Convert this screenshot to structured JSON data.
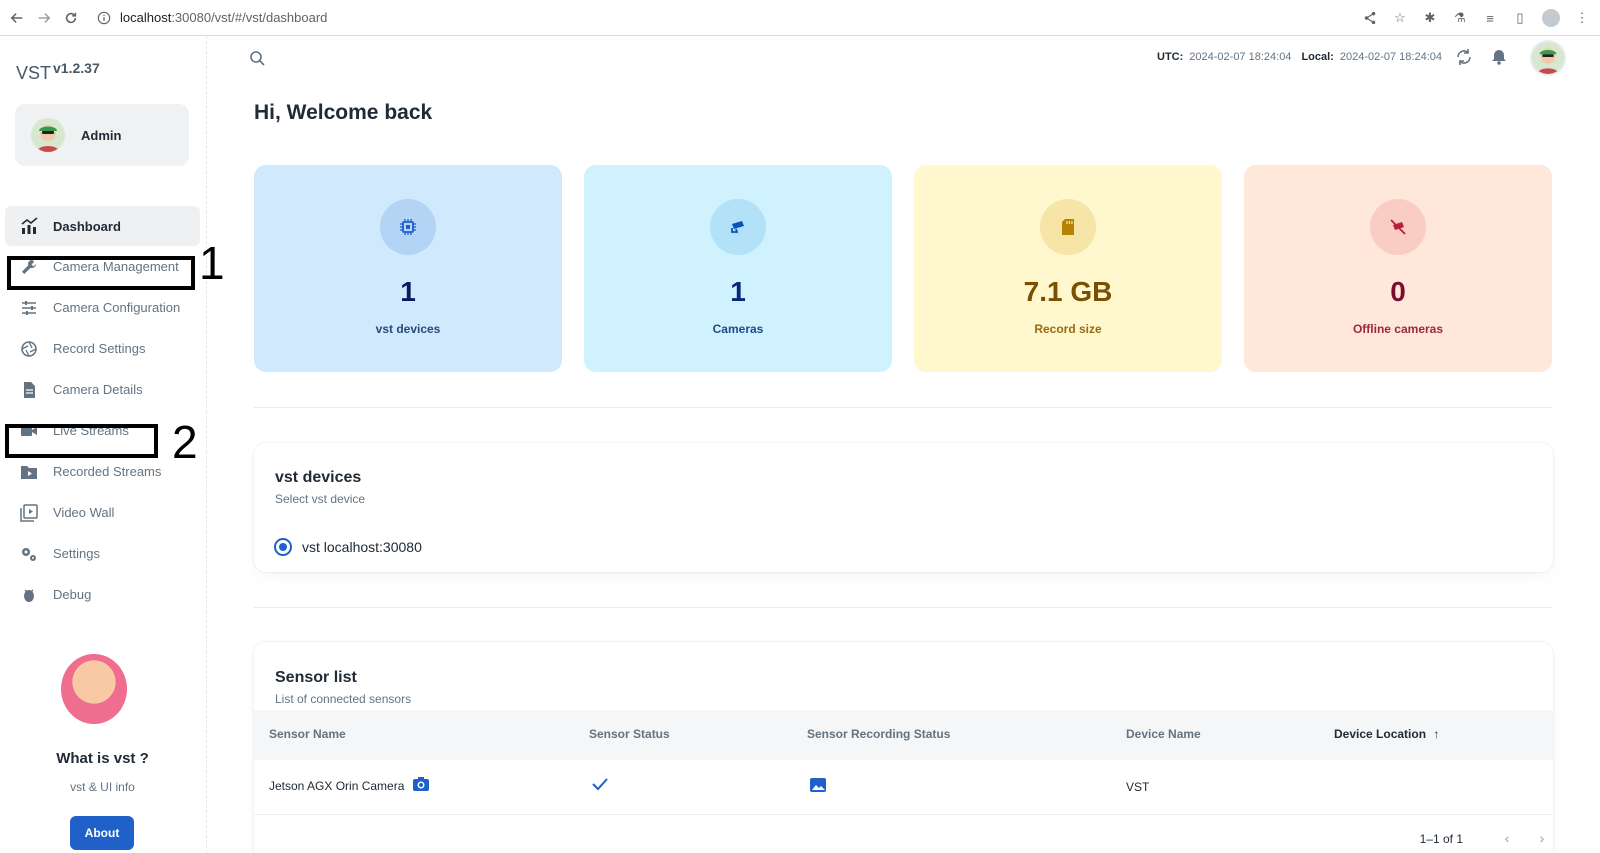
{
  "browser": {
    "url_host": "localhost",
    "url_rest": ":30080/vst/#/vst/dashboard"
  },
  "app": {
    "name": "VST",
    "version": "v1.2.37"
  },
  "user": {
    "name": "Admin"
  },
  "sidebar": {
    "items": [
      {
        "label": "Dashboard",
        "icon": "chart-icon",
        "active": true
      },
      {
        "label": "Camera Management",
        "icon": "wrench-icon"
      },
      {
        "label": "Camera Configuration",
        "icon": "sliders-icon"
      },
      {
        "label": "Record Settings",
        "icon": "aperture-icon"
      },
      {
        "label": "Camera Details",
        "icon": "document-icon"
      },
      {
        "label": "Live Streams",
        "icon": "videocam-icon"
      },
      {
        "label": "Recorded Streams",
        "icon": "folder-video-icon"
      },
      {
        "label": "Video Wall",
        "icon": "video-library-icon"
      },
      {
        "label": "Settings",
        "icon": "gears-icon"
      },
      {
        "label": "Debug",
        "icon": "bug-icon"
      }
    ],
    "annotations": [
      "1",
      "2"
    ],
    "promo": {
      "title": "What is vst ?",
      "subtitle": "vst & UI info",
      "button": "About"
    }
  },
  "topbar": {
    "utc_label": "UTC:",
    "utc_value": "2024-02-07 18:24:04",
    "local_label": "Local:",
    "local_value": "2024-02-07 18:24:04"
  },
  "welcome": "Hi, Welcome back",
  "stats": [
    {
      "value": "1",
      "label": "vst devices",
      "icon": "chip-icon",
      "bg": "#d1e9fc",
      "circle": "#b3d4f5",
      "color": "#061b64",
      "icon_color": "#1f61c8"
    },
    {
      "value": "1",
      "label": "Cameras",
      "icon": "cctv-icon",
      "bg": "#d0f2ff",
      "circle": "#b3e1f7",
      "color": "#04297a",
      "icon_color": "#0c53b7"
    },
    {
      "value": "7.1 GB",
      "label": "Record size",
      "icon": "sd-card-icon",
      "bg": "#fff7cd",
      "circle": "#f7e5a8",
      "color": "#7a4f01",
      "icon_color": "#b78103"
    },
    {
      "value": "0",
      "label": "Offline cameras",
      "icon": "camera-off-icon",
      "bg": "#ffe7d9",
      "circle": "#f9cdc3",
      "color": "#7a0c2e",
      "icon_color": "#b72136"
    }
  ],
  "devices": {
    "title": "vst devices",
    "subtitle": "Select vst device",
    "option": "vst localhost:30080"
  },
  "sensors": {
    "title": "Sensor list",
    "subtitle": "List of connected sensors",
    "columns": [
      "Sensor Name",
      "Sensor Status",
      "Sensor Recording Status",
      "Device Name",
      "Device Location"
    ],
    "rows": [
      {
        "name": "Jetson AGX Orin Camera",
        "status": "check",
        "recording": "image",
        "device": "VST",
        "location": ""
      }
    ],
    "pagination": "1–1 of 1"
  }
}
